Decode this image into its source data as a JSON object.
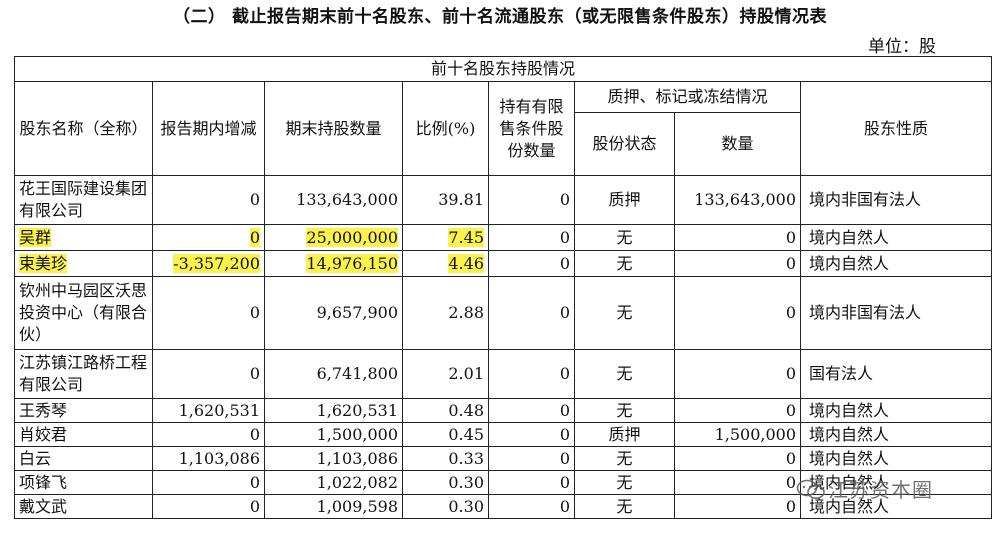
{
  "title": "（二） 截止报告期末前十名股东、前十名流通股东（或无限售条件股东）持股情况表",
  "unit": "单位：股",
  "table": {
    "banner": "前十名股东持股情况",
    "headers": {
      "name": "股东名称（全称）",
      "change": "报告期内增减",
      "holdings": "期末持股数量",
      "ratio": "比例(%)",
      "restricted": "持有有限售条件股份数量",
      "pledge_group": "质押、标记或冻结情况",
      "pledge_status": "股份状态",
      "pledge_qty": "数量",
      "nature": "股东性质"
    },
    "rows": [
      {
        "name": "花王国际建设集团有限公司",
        "change": "0",
        "holdings": "133,643,000",
        "ratio": "39.81",
        "restricted": "0",
        "status": "质押",
        "qty": "133,643,000",
        "nature": "境内非国有法人"
      },
      {
        "name": "吴群",
        "change": "0",
        "holdings": "25,000,000",
        "ratio": "7.45",
        "restricted": "0",
        "status": "无",
        "qty": "0",
        "nature": "境内自然人"
      },
      {
        "name": "束美珍",
        "change": "-3,357,200",
        "holdings": "14,976,150",
        "ratio": "4.46",
        "restricted": "0",
        "status": "无",
        "qty": "0",
        "nature": "境内自然人"
      },
      {
        "name": "钦州中马园区沃思投资中心（有限合伙）",
        "change": "0",
        "holdings": "9,657,900",
        "ratio": "2.88",
        "restricted": "0",
        "status": "无",
        "qty": "0",
        "nature": "境内非国有法人"
      },
      {
        "name": "江苏镇江路桥工程有限公司",
        "change": "0",
        "holdings": "6,741,800",
        "ratio": "2.01",
        "restricted": "0",
        "status": "无",
        "qty": "0",
        "nature": "国有法人"
      },
      {
        "name": "王秀琴",
        "change": "1,620,531",
        "holdings": "1,620,531",
        "ratio": "0.48",
        "restricted": "0",
        "status": "无",
        "qty": "0",
        "nature": "境内自然人"
      },
      {
        "name": "肖姣君",
        "change": "0",
        "holdings": "1,500,000",
        "ratio": "0.45",
        "restricted": "0",
        "status": "质押",
        "qty": "1,500,000",
        "nature": "境内自然人"
      },
      {
        "name": "白云",
        "change": "1,103,086",
        "holdings": "1,103,086",
        "ratio": "0.33",
        "restricted": "0",
        "status": "无",
        "qty": "0",
        "nature": "境内自然人"
      },
      {
        "name": "项锋飞",
        "change": "0",
        "holdings": "1,022,082",
        "ratio": "0.30",
        "restricted": "0",
        "status": "无",
        "qty": "0",
        "nature": "境内自然人"
      },
      {
        "name": "戴文武",
        "change": "0",
        "holdings": "1,009,598",
        "ratio": "0.30",
        "restricted": "0",
        "status": "无",
        "qty": "0",
        "nature": "境内自然人"
      }
    ]
  },
  "watermark": "江苏资本圈",
  "highlight_color": "#fbf24b"
}
